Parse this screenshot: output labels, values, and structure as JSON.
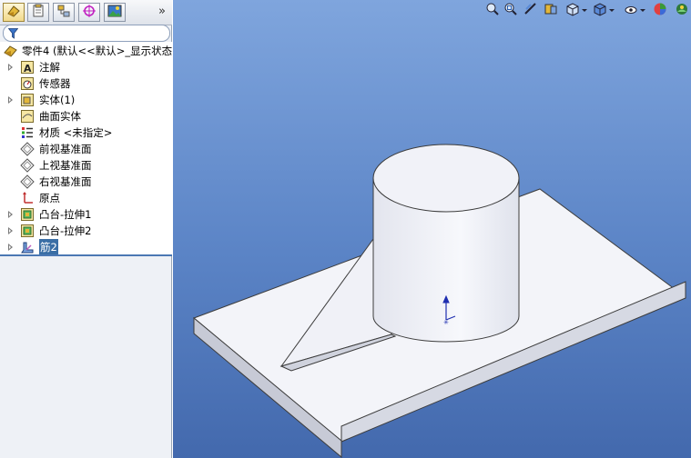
{
  "panel": {
    "tabs": [
      {
        "name": "featuremanager-tab-icon"
      },
      {
        "name": "propertymanager-tab-icon"
      },
      {
        "name": "configurationmanager-tab-icon"
      },
      {
        "name": "dimxpert-tab-icon"
      },
      {
        "name": "display-manager-tab-icon"
      }
    ],
    "expand_glyph": "»",
    "tree": {
      "root": "零件4 (默认<<默认>_显示状态",
      "items": [
        {
          "label": "注解",
          "icon": "annotations-icon",
          "expandable": true
        },
        {
          "label": "传感器",
          "icon": "sensors-icon",
          "expandable": false
        },
        {
          "label": "实体(1)",
          "icon": "solid-bodies-icon",
          "expandable": true
        },
        {
          "label": "曲面实体",
          "icon": "surface-bodies-icon",
          "expandable": false
        },
        {
          "label": "材质 <未指定>",
          "icon": "material-icon",
          "expandable": false
        },
        {
          "label": "前视基准面",
          "icon": "plane-icon",
          "expandable": false
        },
        {
          "label": "上视基准面",
          "icon": "plane-icon",
          "expandable": false
        },
        {
          "label": "右视基准面",
          "icon": "plane-icon",
          "expandable": false
        },
        {
          "label": "原点",
          "icon": "origin-icon",
          "expandable": false
        },
        {
          "label": "凸台-拉伸1",
          "icon": "boss-extrude-icon",
          "expandable": true
        },
        {
          "label": "凸台-拉伸2",
          "icon": "boss-extrude-icon",
          "expandable": true
        },
        {
          "label": "筋2",
          "icon": "rib-icon",
          "expandable": true,
          "selected": true
        }
      ]
    }
  },
  "headsup_toolbar": [
    "zoom-to-fit-icon",
    "zoom-to-area-icon",
    "previous-view-icon",
    "section-view-icon",
    "view-orientation-icon",
    "display-style-icon",
    "hide-show-items-icon",
    "edit-appearance-icon",
    "apply-scene-icon"
  ],
  "colors": {
    "viewport_top": "#7fa5dd",
    "viewport_bottom": "#4369ad",
    "selection": "#3a6ea5",
    "model_face": "#f4f5f9"
  }
}
